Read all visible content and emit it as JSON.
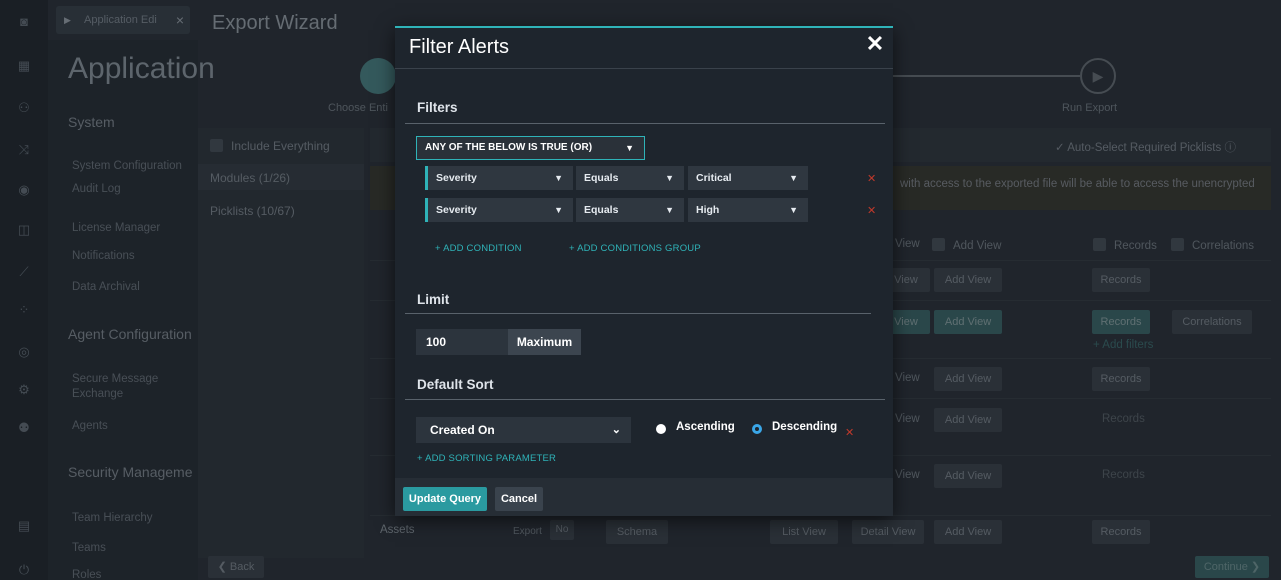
{
  "tab": {
    "label": "Application Edi"
  },
  "app": {
    "title": "Application"
  },
  "sidebar": {
    "sections": [
      {
        "label": "System"
      },
      {
        "label": "Agent Configuration"
      },
      {
        "label": "Security Manageme"
      }
    ],
    "items": [
      "System Configuration",
      "Audit Log",
      "License Manager",
      "Notifications",
      "Data Archival",
      "Secure Message",
      "Exchange",
      "Agents",
      "Team Hierarchy",
      "Teams",
      "Roles"
    ]
  },
  "wizard": {
    "title": "Export Wizard",
    "step1_label": "Choose Enti",
    "step3_label": "Run Export",
    "include_everything": "Include Everything",
    "modules": "Modules (1/26)",
    "picklists": "Picklists (10/67)",
    "auto_select": "Auto-Select Required Picklists",
    "warning": "with access to the exported file will be able to access the unencrypted",
    "header_view": "View",
    "header_add_view": "Add View",
    "header_records": "Records",
    "header_correlations": "Correlations",
    "rows": [
      {
        "view": "View",
        "add_view": "Add View",
        "records": "Records",
        "correlations": ""
      },
      {
        "view": "View",
        "add_view": "Add View",
        "records": "Records",
        "correlations": "Correlations",
        "add_filters": "+ Add filters"
      },
      {
        "view": "View",
        "add_view": "Add View",
        "records": "Records",
        "correlations": ""
      },
      {
        "view": "View",
        "add_view": "Add View",
        "records": "Records",
        "correlations": ""
      },
      {
        "view": "View",
        "add_view": "Add View",
        "records": "Records",
        "correlations": ""
      }
    ],
    "assets_row": {
      "name": "Assets",
      "export": "Export",
      "no": "No",
      "schema": "Schema",
      "list_view": "List View",
      "detail_view": "Detail View",
      "add_view": "Add View",
      "records": "Records"
    },
    "back": "Back",
    "continue": "Continue"
  },
  "modal": {
    "title": "Filter Alerts",
    "filters_heading": "Filters",
    "logic": "ANY OF THE BELOW IS TRUE (OR)",
    "conditions": [
      {
        "field": "Severity",
        "operator": "Equals",
        "value": "Critical"
      },
      {
        "field": "Severity",
        "operator": "Equals",
        "value": "High"
      }
    ],
    "add_condition": "+ ADD CONDITION",
    "add_group": "+ ADD CONDITIONS GROUP",
    "limit_heading": "Limit",
    "limit_value": "100",
    "limit_max": "Maximum",
    "sort_heading": "Default Sort",
    "sort_field": "Created On",
    "ascending": "Ascending",
    "descending": "Descending",
    "add_sort": "+ ADD SORTING PARAMETER",
    "update": "Update Query",
    "cancel": "Cancel"
  }
}
